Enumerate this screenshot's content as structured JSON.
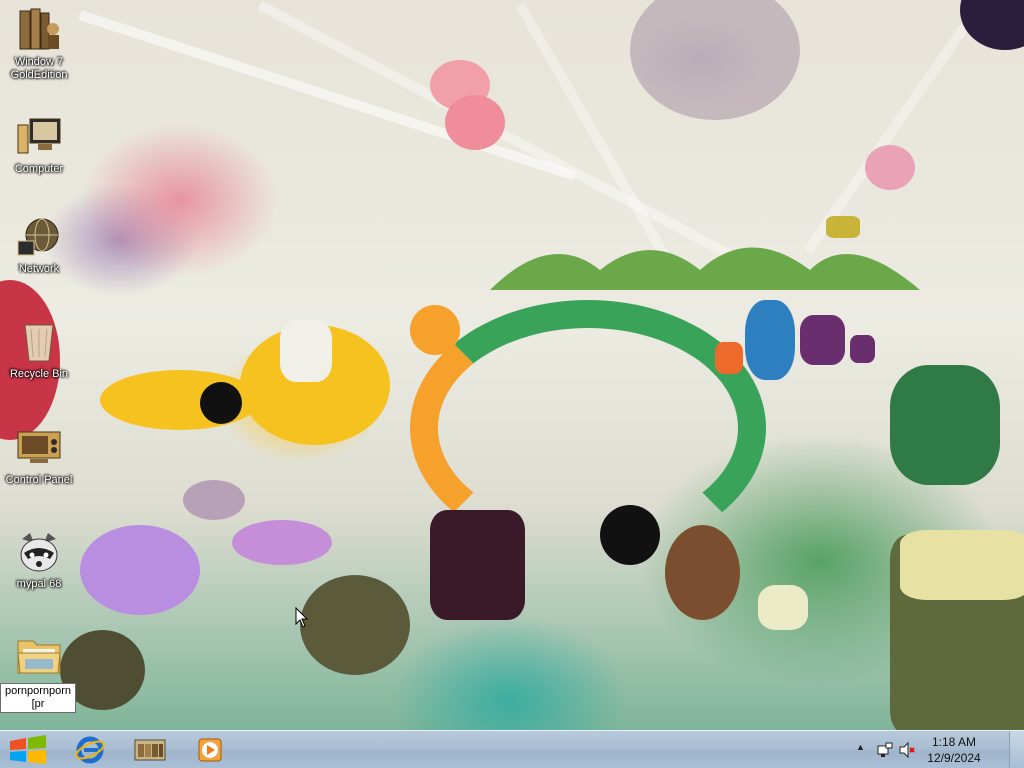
{
  "desktop": {
    "icons": [
      {
        "label": "Window 7 GoldEdition",
        "icon": "books-icon"
      },
      {
        "label": "Computer",
        "icon": "computer-icon"
      },
      {
        "label": "Network",
        "icon": "network-icon"
      },
      {
        "label": "Recycle Bin",
        "icon": "recycle-bin-icon"
      },
      {
        "label": "Control Panel",
        "icon": "control-panel-icon"
      },
      {
        "label": "mypal 68",
        "icon": "raccoon-icon"
      },
      {
        "label": "",
        "icon": "folder-icon"
      }
    ],
    "rename_field": {
      "value": "pornpornporn[pr"
    }
  },
  "taskbar": {
    "pinned": [
      {
        "name": "internet-explorer",
        "icon": "internet-explorer-icon"
      },
      {
        "name": "library",
        "icon": "library-icon"
      },
      {
        "name": "media-player",
        "icon": "media-player-icon"
      }
    ],
    "clock": {
      "time": "1:18 AM",
      "date": "12/9/2024"
    },
    "tray_arrow": "▲"
  },
  "colors": {
    "taskbar": "#a9bdd2",
    "icon_label": "#ffffff"
  }
}
